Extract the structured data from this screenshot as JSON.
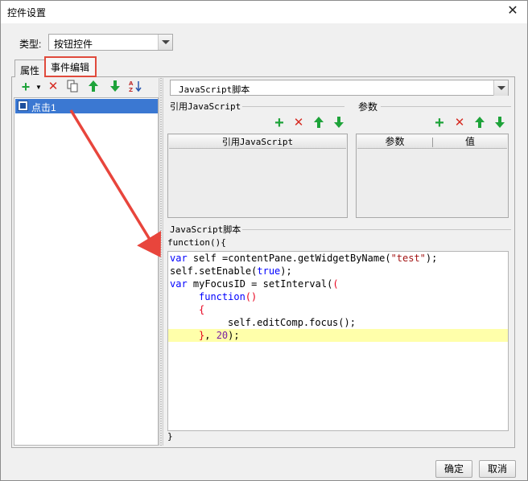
{
  "window": {
    "title": "控件设置"
  },
  "type_field": {
    "label": "类型:",
    "value": "按钮控件"
  },
  "tabs": [
    {
      "label": "属性"
    },
    {
      "label": "事件编辑"
    }
  ],
  "events": [
    {
      "label": "点击1",
      "selected": true
    }
  ],
  "script": {
    "type_value": "JavaScript脚本",
    "ref_group_title": "引用JavaScript",
    "params_group_title": "参数",
    "ref_column": "引用JavaScript",
    "params_columns": [
      "参数",
      "值"
    ],
    "code_group_title": "JavaScript脚本",
    "function_open": "function(){",
    "function_close": "}",
    "code": {
      "l1a": "var",
      "l1b": " self =contentPane.getWidgetByName(",
      "l1c": "\"test\"",
      "l1d": ");",
      "l2a": "self.setEnable(",
      "l2b": "true",
      "l2c": ");",
      "l3a": "var",
      "l3b": " myFocusID = setInterval(",
      "l4a": "function",
      "l4b": "()",
      "l5": "{",
      "l6": "self.editComp.focus();",
      "l7a": "}",
      "l7b": ", ",
      "l7c": "20",
      "l7d": ");"
    }
  },
  "buttons": {
    "ok": "确定",
    "cancel": "取消"
  },
  "colors": {
    "selection": "#3b78d2",
    "highlight_annotation": "#e04a3c",
    "add": "#1ea33a",
    "delete": "#d62b22"
  },
  "icons": [
    "add-icon",
    "delete-icon",
    "copy-icon",
    "move-up-icon",
    "move-down-icon",
    "sort-icon",
    "close-icon",
    "button-widget-icon"
  ]
}
